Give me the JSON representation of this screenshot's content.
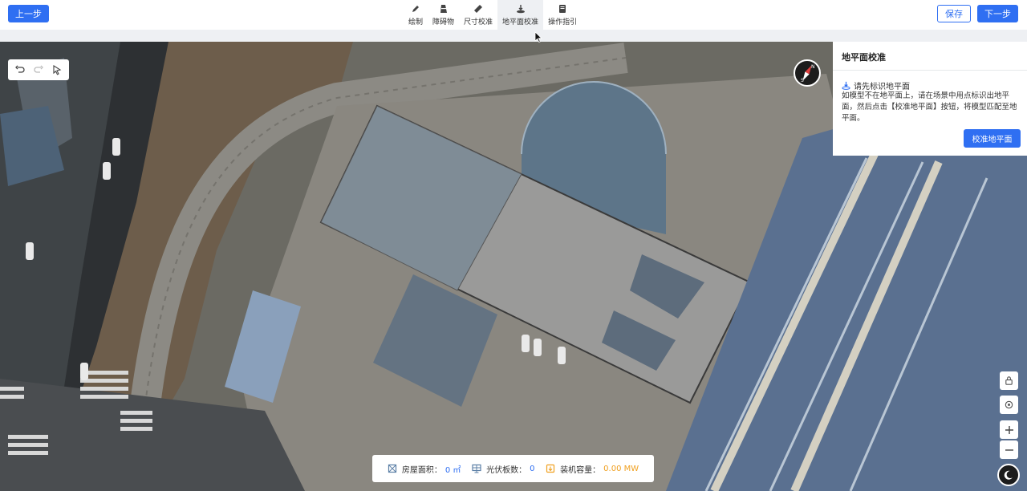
{
  "toolbar": {
    "prev_label": "上一步",
    "save_label": "保存",
    "next_label": "下一步",
    "tools": [
      {
        "label": "绘制",
        "icon": "pen-icon"
      },
      {
        "label": "障碍物",
        "icon": "obstacle-icon"
      },
      {
        "label": "尺寸校准",
        "icon": "ruler-icon"
      },
      {
        "label": "地平面校准",
        "icon": "ground-plane-icon",
        "active": true
      },
      {
        "label": "操作指引",
        "icon": "guide-book-icon"
      }
    ]
  },
  "panel": {
    "title": "地平面校准",
    "step_title": "请先标识地平面",
    "description": "如模型不在地平面上，请在场景中用点标识出地平面，然后点击【校准地平面】按钮，将模型匹配至地平面。",
    "button_label": "校准地平面"
  },
  "stats": {
    "area_label": "房屋面积：",
    "area_value": "0 ㎡",
    "panels_label": "光伏板数：",
    "panels_value": "0",
    "capacity_label": "装机容量：",
    "capacity_value": "0.00 MW"
  },
  "colors": {
    "primary": "#2f6ff2",
    "capacity": "#f0a020"
  }
}
